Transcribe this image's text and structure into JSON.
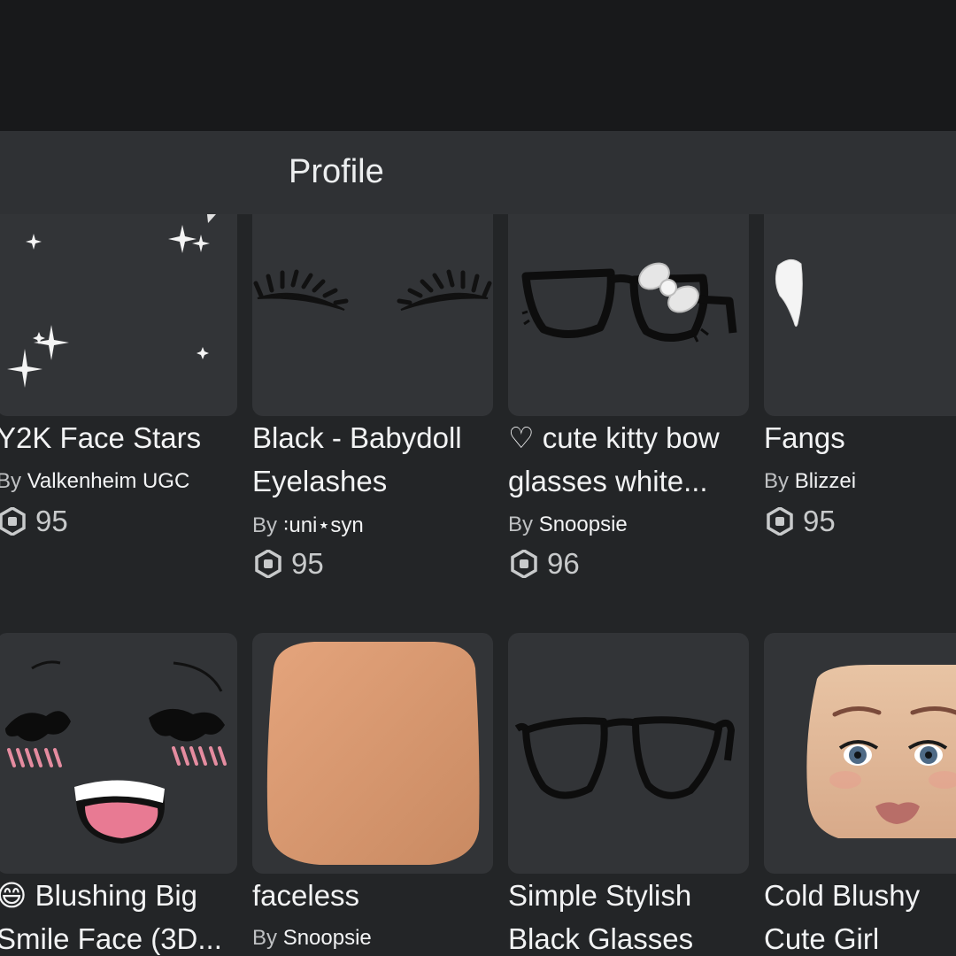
{
  "header": {
    "title": "Profile"
  },
  "items": [
    {
      "name_lines": [
        "Y2K Face Stars"
      ],
      "by": "By",
      "creator": "Valkenheim UGC",
      "price": "95",
      "thumb_icon": "sparkle-stars-icon"
    },
    {
      "name_lines": [
        "Black - Babydoll",
        "Eyelashes"
      ],
      "by": "By",
      "creator": "꞉uni⋆syn",
      "price": "95",
      "thumb_icon": "eyelashes-icon"
    },
    {
      "name_lines": [
        "♡ cute kitty bow",
        "glasses white..."
      ],
      "by": "By",
      "creator": "Snoopsie",
      "price": "96",
      "thumb_icon": "kitty-bow-glasses-icon"
    },
    {
      "name_lines": [
        "Fangs"
      ],
      "by": "By",
      "creator": "Blizzei",
      "price": "95",
      "thumb_icon": "fang-icon"
    },
    {
      "name_lines": [
        "😄 Blushing Big",
        "Smile Face (3D..."
      ],
      "thumb_icon": "blushing-smile-face-icon"
    },
    {
      "name_lines": [
        "faceless"
      ],
      "by": "By",
      "creator": "Snoopsie",
      "thumb_icon": "faceless-head-icon"
    },
    {
      "name_lines": [
        "Simple Stylish",
        "Black Glasses"
      ],
      "thumb_icon": "black-glasses-icon"
    },
    {
      "name_lines": [
        "Cold Blushy",
        "Cute Girl"
      ],
      "thumb_icon": "cute-girl-head-icon"
    }
  ],
  "colors": {
    "background": "#232527",
    "topbar": "#18191b",
    "header": "#2f3134",
    "card": "#323437",
    "robux": "#c8cacb"
  }
}
